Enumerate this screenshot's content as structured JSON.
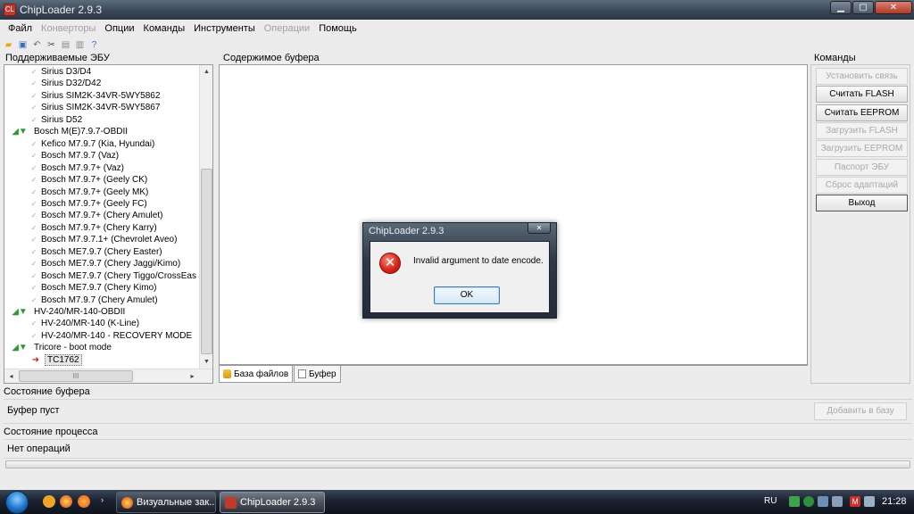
{
  "window": {
    "title": "ChipLoader 2.9.3",
    "app_icon_text": "CL"
  },
  "menu": [
    {
      "label": "Файл",
      "disabled": false
    },
    {
      "label": "Конверторы",
      "disabled": true
    },
    {
      "label": "Опции",
      "disabled": false
    },
    {
      "label": "Команды",
      "disabled": false
    },
    {
      "label": "Инструменты",
      "disabled": false
    },
    {
      "label": "Операции",
      "disabled": true
    },
    {
      "label": "Помощь",
      "disabled": false
    }
  ],
  "toolbar_icons": [
    "open-icon",
    "save-icon",
    "undo-icon",
    "cut-icon",
    "copy-icon",
    "paste-icon",
    "help-icon"
  ],
  "sections": {
    "supported_ecu": "Поддерживаемые ЭБУ",
    "buffer_contents": "Содержимое буфера",
    "commands": "Команды",
    "buffer_state": "Состояние буфера",
    "process_state": "Состояние процесса"
  },
  "tree": [
    {
      "label": "Sirius D3/D4",
      "level": 1
    },
    {
      "label": "Sirius D32/D42",
      "level": 1
    },
    {
      "label": "Sirius SIM2K-34VR-5WY5862",
      "level": 1
    },
    {
      "label": "Sirius SIM2K-34VR-5WY5867",
      "level": 1
    },
    {
      "label": "Sirius D52",
      "level": 1
    },
    {
      "label": "Bosch M(E)7.9.7-OBDII",
      "level": 0
    },
    {
      "label": "Kefico M7.9.7 (Kia, Hyundai)",
      "level": 1
    },
    {
      "label": "Bosch M7.9.7 (Vaz)",
      "level": 1
    },
    {
      "label": "Bosch M7.9.7+ (Vaz)",
      "level": 1
    },
    {
      "label": "Bosch M7.9.7+ (Geely CK)",
      "level": 1
    },
    {
      "label": "Bosch M7.9.7+ (Geely MK)",
      "level": 1
    },
    {
      "label": "Bosch M7.9.7+ (Geely FC)",
      "level": 1
    },
    {
      "label": "Bosch M7.9.7+ (Chery Amulet)",
      "level": 1
    },
    {
      "label": "Bosch M7.9.7+ (Chery Karry)",
      "level": 1
    },
    {
      "label": "Bosch M7.9.7.1+ (Chevrolet Aveo)",
      "level": 1
    },
    {
      "label": "Bosch ME7.9.7 (Chery Easter)",
      "level": 1
    },
    {
      "label": "Bosch ME7.9.7 (Chery Jaggi/Kimo)",
      "level": 1
    },
    {
      "label": "Bosch ME7.9.7 (Chery Tiggo/CrossEas",
      "level": 1
    },
    {
      "label": "Bosch ME7.9.7 (Chery Kimo)",
      "level": 1
    },
    {
      "label": "Bosch M7.9.7 (Chery Amulet)",
      "level": 1
    },
    {
      "label": "HV-240/MR-140-OBDII",
      "level": 0
    },
    {
      "label": "HV-240/MR-140 (K-Line)",
      "level": 1
    },
    {
      "label": "HV-240/MR-140 - RECOVERY MODE",
      "level": 1
    },
    {
      "label": "Tricore - boot mode",
      "level": 0
    },
    {
      "label": "TC1762",
      "level": 1,
      "selected": true
    }
  ],
  "tree_hscroll_label": "III",
  "tabs": [
    {
      "label": "База файлов",
      "icon": "database-icon",
      "active": true
    },
    {
      "label": "Буфер",
      "icon": "buffer-icon",
      "active": false
    }
  ],
  "commands": [
    {
      "label": "Установить связь",
      "disabled": true
    },
    {
      "label": "Считать FLASH",
      "disabled": false
    },
    {
      "label": "Считать EEPROM",
      "disabled": false
    },
    {
      "label": "Загрузить FLASH",
      "disabled": true
    },
    {
      "label": "Загрузить EEPROM",
      "disabled": true
    },
    {
      "label": "Паспорт ЭБУ",
      "disabled": true
    },
    {
      "label": "Сброс адаптаций",
      "disabled": true
    },
    {
      "label": "Выход",
      "disabled": false
    }
  ],
  "buffer_status": "Буфер пуст",
  "add_to_db_label": "Добавить в базу",
  "process_status": "Нет операций",
  "dialog": {
    "title": "ChipLoader 2.9.3",
    "message": "Invalid argument to date encode.",
    "ok_label": "OK",
    "close_glyph": "✕",
    "icon_glyph": "✕"
  },
  "taskbar": {
    "items": [
      {
        "label": "Визуальные зак...",
        "active": false
      },
      {
        "label": "ChipLoader 2.9.3",
        "active": true
      }
    ],
    "lang": "RU",
    "clock": "21:28"
  }
}
